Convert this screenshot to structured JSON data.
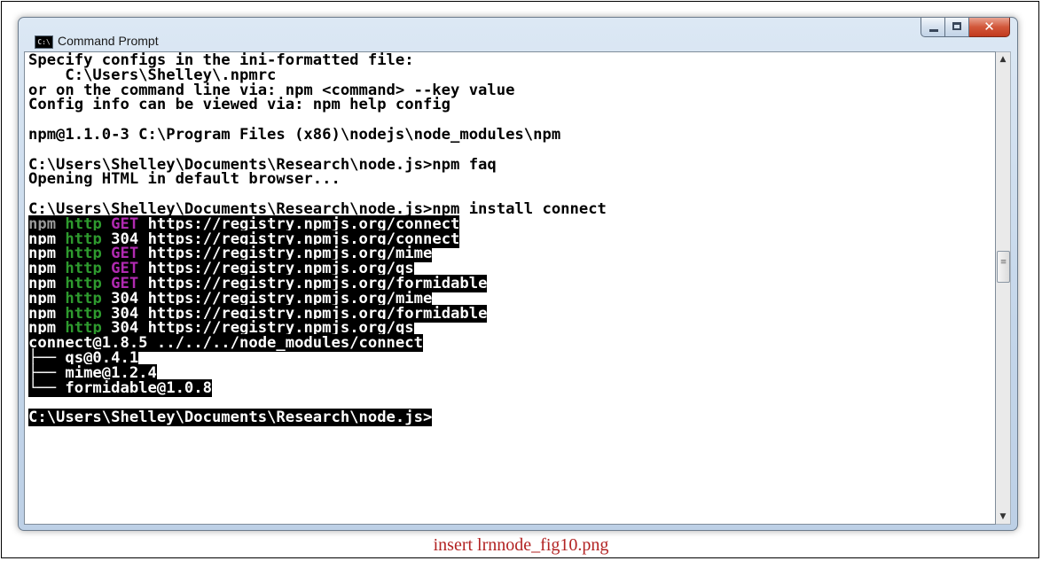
{
  "window": {
    "title": "Command Prompt",
    "app_icon_text": "C:\\",
    "minimize_glyph": "",
    "close_glyph": "✕"
  },
  "console": {
    "lines": [
      [
        {
          "text": "Specify configs in the ini-formatted file:"
        }
      ],
      [
        {
          "text": "    C:\\Users\\Shelley\\.npmrc"
        }
      ],
      [
        {
          "text": "or on the command line via: npm <command> --key value"
        }
      ],
      [
        {
          "text": "Config info can be viewed via: npm help config"
        }
      ],
      [
        {
          "text": ""
        }
      ],
      [
        {
          "text": "npm@1.1.0-3 C:\\Program Files (x86)\\nodejs\\node_modules\\npm"
        }
      ],
      [
        {
          "text": ""
        }
      ],
      [
        {
          "text": "C:\\Users\\Shelley\\Documents\\Research\\node.js>npm faq"
        }
      ],
      [
        {
          "text": "Opening HTML in default browser..."
        }
      ],
      [
        {
          "text": ""
        }
      ],
      [
        {
          "text": "C:\\Users\\Shelley\\Documents\\Research\\node.js>npm install connect"
        }
      ],
      [
        {
          "text": "npm ",
          "cls": "npm-gray"
        },
        {
          "text": "http ",
          "cls": "inv seg-http"
        },
        {
          "text": "GET ",
          "cls": "inv seg-get"
        },
        {
          "text": "https://registry.npmjs.org/connect",
          "cls": "inv seg-url"
        }
      ],
      [
        {
          "text": "npm ",
          "cls": "inv"
        },
        {
          "text": "http ",
          "cls": "inv seg-http"
        },
        {
          "text": "304 ",
          "cls": "inv seg-code"
        },
        {
          "text": "https://registry.npmjs.org/connect",
          "cls": "inv seg-url"
        }
      ],
      [
        {
          "text": "npm ",
          "cls": "inv"
        },
        {
          "text": "http ",
          "cls": "inv seg-http"
        },
        {
          "text": "GET ",
          "cls": "inv seg-get"
        },
        {
          "text": "https://registry.npmjs.org/mime",
          "cls": "inv seg-url"
        }
      ],
      [
        {
          "text": "npm ",
          "cls": "inv"
        },
        {
          "text": "http ",
          "cls": "inv seg-http"
        },
        {
          "text": "GET ",
          "cls": "inv seg-get"
        },
        {
          "text": "https://registry.npmjs.org/qs",
          "cls": "inv seg-url"
        }
      ],
      [
        {
          "text": "npm ",
          "cls": "inv"
        },
        {
          "text": "http ",
          "cls": "inv seg-http"
        },
        {
          "text": "GET ",
          "cls": "inv seg-get"
        },
        {
          "text": "https://registry.npmjs.org/formidable",
          "cls": "inv seg-url"
        }
      ],
      [
        {
          "text": "npm ",
          "cls": "inv"
        },
        {
          "text": "http ",
          "cls": "inv seg-http"
        },
        {
          "text": "304 ",
          "cls": "inv seg-code"
        },
        {
          "text": "https://registry.npmjs.org/mime",
          "cls": "inv seg-url"
        }
      ],
      [
        {
          "text": "npm ",
          "cls": "inv"
        },
        {
          "text": "http ",
          "cls": "inv seg-http"
        },
        {
          "text": "304 ",
          "cls": "inv seg-code"
        },
        {
          "text": "https://registry.npmjs.org/formidable",
          "cls": "inv seg-url"
        }
      ],
      [
        {
          "text": "npm ",
          "cls": "inv"
        },
        {
          "text": "http ",
          "cls": "inv seg-http"
        },
        {
          "text": "304 ",
          "cls": "inv seg-code"
        },
        {
          "text": "https://registry.npmjs.org/qs",
          "cls": "inv seg-url"
        }
      ],
      [
        {
          "text": "connect@1.8.5 ../../../node_modules/connect",
          "cls": "inv"
        }
      ],
      [
        {
          "text": "├── qs@0.4.1",
          "cls": "inv"
        }
      ],
      [
        {
          "text": "├── mime@1.2.4",
          "cls": "inv"
        }
      ],
      [
        {
          "text": "└── formidable@1.0.8",
          "cls": "inv"
        }
      ],
      [
        {
          "text": ""
        }
      ],
      [
        {
          "text": "C:\\Users\\Shelley\\Documents\\Research\\node.js>",
          "cls": "inv"
        }
      ]
    ]
  },
  "scrollbar": {
    "up_arrow": "▲",
    "down_arrow": "▼",
    "grip": "≡"
  },
  "caption": "insert lrnnode_fig10.png"
}
